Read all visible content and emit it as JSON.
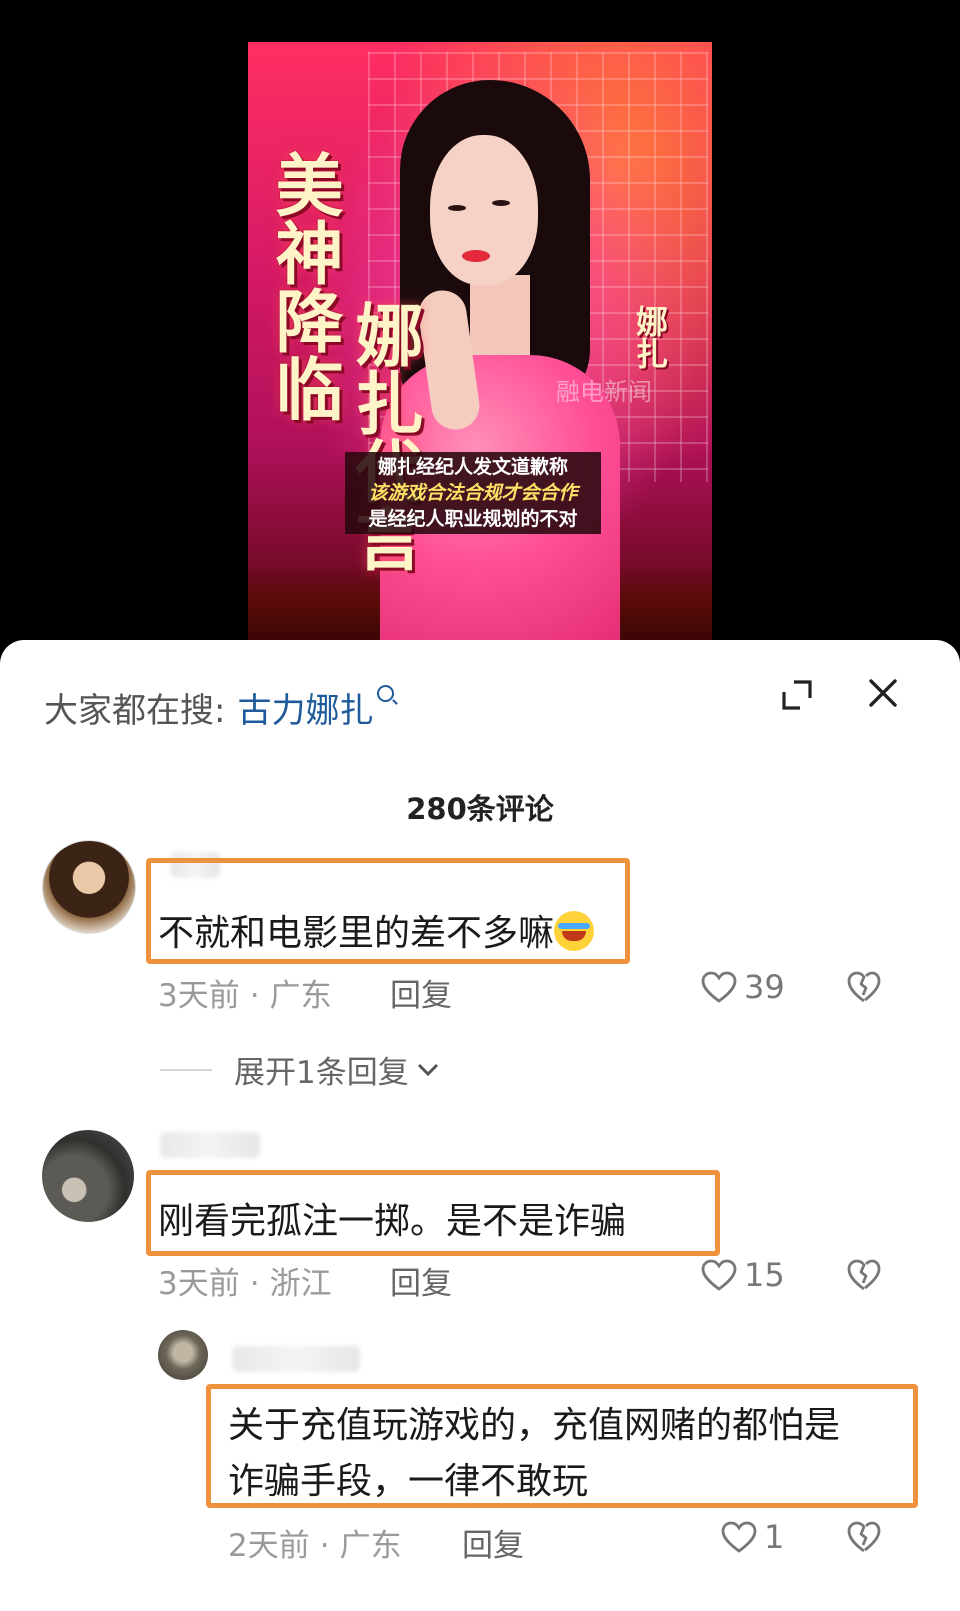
{
  "poster": {
    "title_a": "美神降临",
    "title_b": "娜扎代言",
    "side_name": "娜扎",
    "watermark": "融电新闻",
    "caption_line1": "娜扎经纪人发文道歉称",
    "caption_line2": "该游戏合法合规才会合作",
    "caption_line3": "是经纪人职业规划的不对"
  },
  "sheet": {
    "search_label": "大家都在搜:",
    "search_term": "古力娜扎",
    "comment_count": "280条评论"
  },
  "comments": [
    {
      "text": "不就和电影里的差不多嘛",
      "emoji": "laughing-crying-emoji",
      "time": "3天前",
      "location": "广东",
      "reply": "回复",
      "likes": "39",
      "expand": "展开1条回复"
    },
    {
      "text": "刚看完孤注一掷。是不是诈骗",
      "time": "3天前",
      "location": "浙江",
      "reply": "回复",
      "likes": "15"
    }
  ],
  "replies": [
    {
      "text_line1": "关于充值玩游戏的，充值网赌的都怕是",
      "text_line2": "诈骗手段，一律不敢玩",
      "time": "2天前",
      "location": "广东",
      "reply": "回复",
      "likes": "1"
    }
  ],
  "colors": {
    "highlight_border": "#f0913e",
    "search_term": "#1f5a9a",
    "meta_gray": "#9a9a9a"
  }
}
